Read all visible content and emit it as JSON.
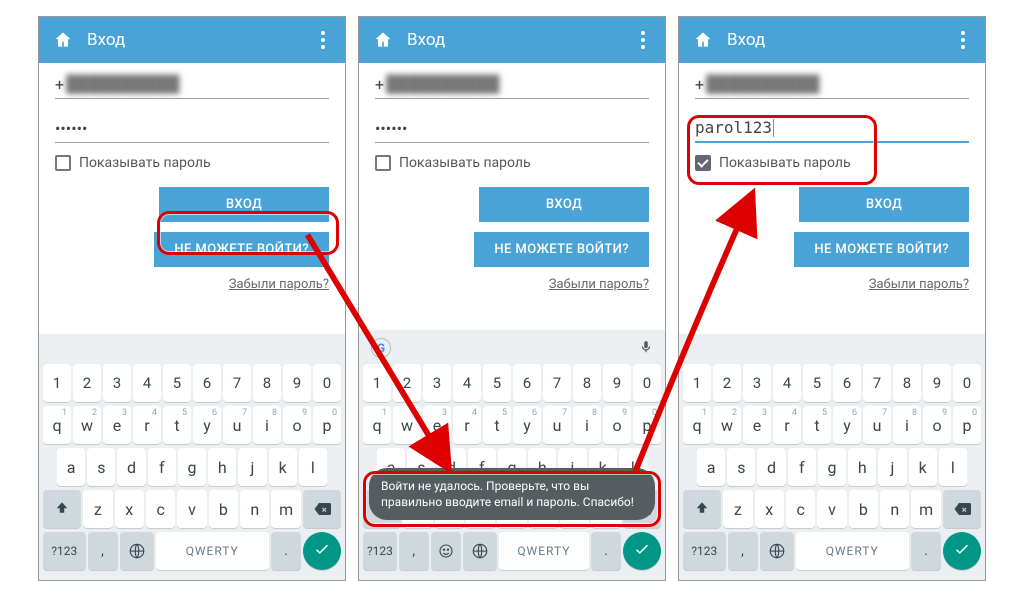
{
  "appbar": {
    "title": "Вход"
  },
  "form": {
    "phone_prefix": "+",
    "phone_blurred": "██████████",
    "password_hidden": "••••••",
    "password_shown": "parol123",
    "show_password_label": "Показывать пароль",
    "login_btn": "ВХОД",
    "trouble_btn": "НЕ МОЖЕТЕ ВОЙТИ?",
    "forgot": "Забыли пароль?"
  },
  "toast": {
    "text": "Войти не удалось. Проверьте, что вы правильно вводите email и пароль. Спасибо!"
  },
  "keyboard": {
    "numrow": [
      "1",
      "2",
      "3",
      "4",
      "5",
      "6",
      "7",
      "8",
      "9",
      "0"
    ],
    "row1": [
      "q",
      "w",
      "e",
      "r",
      "t",
      "y",
      "u",
      "i",
      "o",
      "p"
    ],
    "row2": [
      "a",
      "s",
      "d",
      "f",
      "g",
      "h",
      "j",
      "k",
      "l"
    ],
    "row3": [
      "z",
      "x",
      "c",
      "v",
      "b",
      "n",
      "m"
    ],
    "switch_label": "?123",
    "space_label": "QWERTY",
    "comma": ",",
    "period": "."
  }
}
